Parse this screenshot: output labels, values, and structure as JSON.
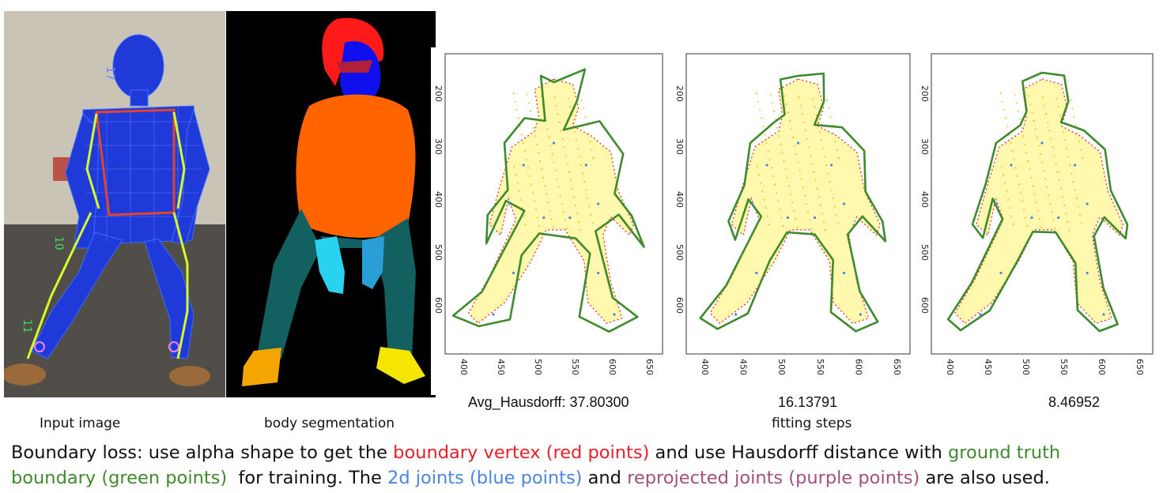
{
  "panels": {
    "input_caption": "Input image",
    "segmentation_caption": "body segmentation",
    "fitting_caption": "fitting steps",
    "photo_joint_labels": [
      "17",
      "10",
      "11"
    ]
  },
  "fitting": {
    "metric_label": "Avg_Hausdorff:",
    "values": [
      "37.80300",
      "16.13791",
      "8.46952"
    ],
    "x_tick_labels": [
      "400",
      "450",
      "500",
      "550",
      "600",
      "650"
    ],
    "y_tick_labels": [
      "200",
      "300",
      "400",
      "500",
      "600"
    ]
  },
  "footer": {
    "line1_a": "Boundary loss: use alpha shape to get the ",
    "line1_red": "boundary vertex (red points)",
    "line1_b": " and use Hausdorff distance with ",
    "line1_green": "ground truth",
    "line2_green": "boundary (green points)",
    "line2_a": "  for training. The ",
    "line2_blue": "2d joints (blue points)",
    "line2_b": " and ",
    "line2_purple": "reprojected joints (purple points)",
    "line2_c": " are also used."
  },
  "colors": {
    "boundary_red": "#e8202a",
    "ground_truth_green": "#3f8a2c",
    "joints_blue": "#4a86e0",
    "reprojected_purple": "#a4507a",
    "mesh_yellow": "#fff36a",
    "seg_head": "#ff1a1a",
    "seg_face": "#1010ee",
    "seg_torso": "#ff6400",
    "seg_legs": "#136060",
    "seg_hands": "#29d3f0",
    "seg_feet_left": "#f5a500",
    "seg_feet_right": "#f5e600"
  }
}
